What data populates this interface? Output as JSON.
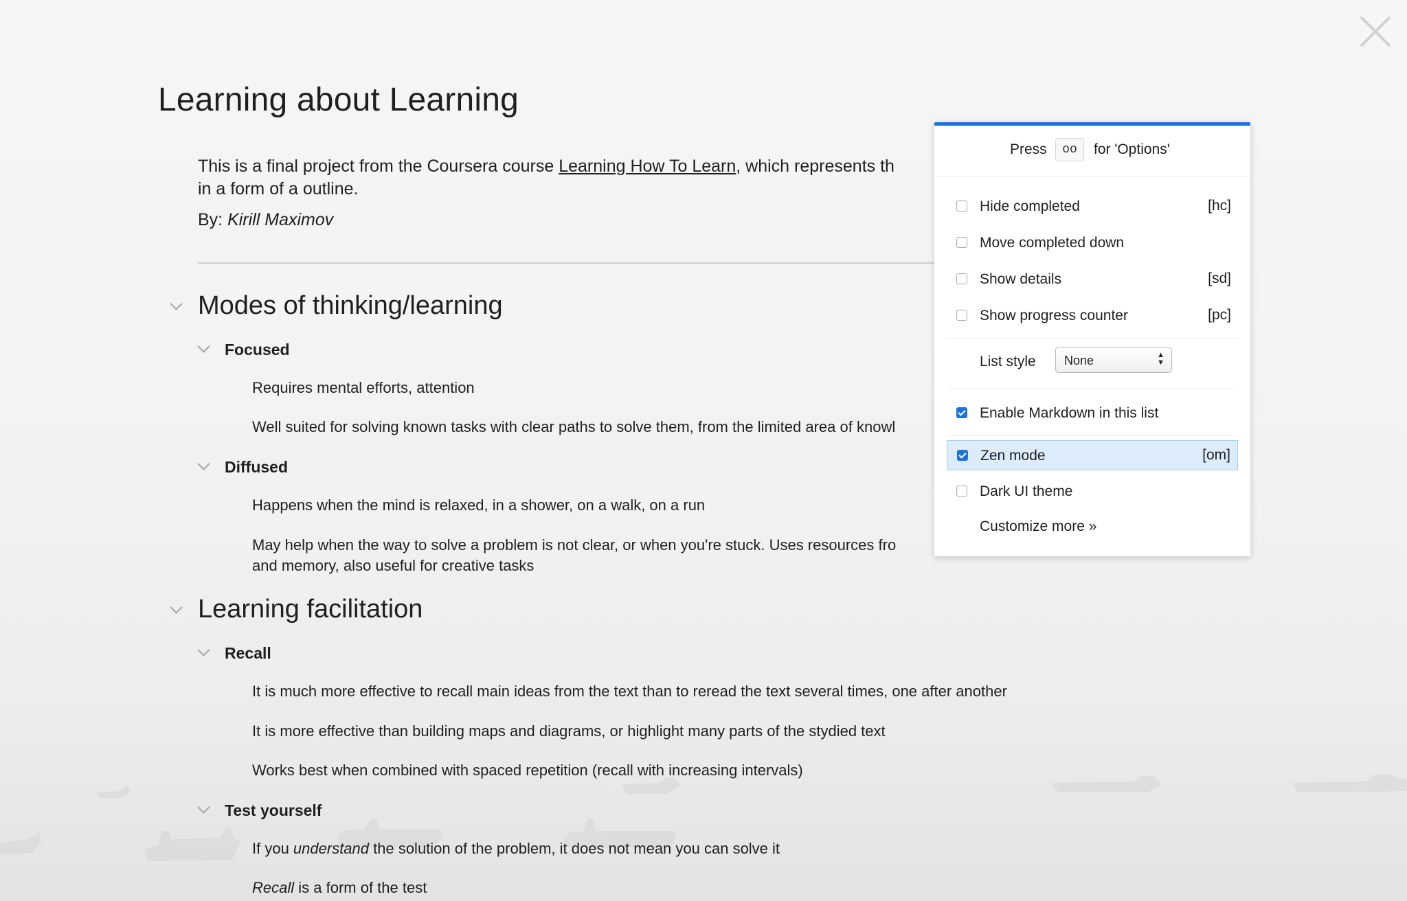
{
  "window": {
    "close_icon": "close-icon"
  },
  "doc": {
    "title": "Learning about Learning",
    "intro_before": "This is a final project from the Coursera course ",
    "intro_link": "Learning How To Learn",
    "intro_after": ", which represents th",
    "intro_line2": "in a form of a outline.",
    "by_prefix": "By: ",
    "author": "Kirill Maximov"
  },
  "outline": {
    "s1": {
      "title": "Modes of thinking/learning",
      "focused": {
        "title": "Focused",
        "n1": "Requires mental efforts, attention",
        "n2": "Well suited for solving known tasks with clear paths to solve them, from the limited area of knowl"
      },
      "diffused": {
        "title": "Diffused",
        "n1": "Happens when the mind is relaxed, in a shower, on a walk, on a run",
        "n2a": "May help when the way to solve a problem is not clear, or when you're stuck. Uses resources fro",
        "n2b": "and memory, also useful for creative tasks"
      }
    },
    "s2": {
      "title": "Learning facilitation",
      "recall": {
        "title": "Recall",
        "n1": "It is much more effective to recall main ideas from the text than to reread the text several times, one after another",
        "n2": "It is more effective than building maps and diagrams, or highlight many parts of the stydied text",
        "n3": "Works best when combined with spaced repetition (recall with increasing intervals)"
      },
      "test": {
        "title": "Test yourself",
        "n1a": "If you ",
        "n1b": "understand",
        "n1c": " the solution of the problem, it does not mean you can solve it",
        "n2a": "Recall",
        "n2b": " is a form of the test"
      }
    }
  },
  "options": {
    "press_label": "Press",
    "press_key": "oo",
    "press_suffix": "for 'Options'",
    "items": [
      {
        "label": "Hide completed",
        "key": "[hc]",
        "checked": false
      },
      {
        "label": "Move completed down",
        "key": "",
        "checked": false
      },
      {
        "label": "Show details",
        "key": "[sd]",
        "checked": false
      },
      {
        "label": "Show progress counter",
        "key": "[pc]",
        "checked": false
      }
    ],
    "list_style_label": "List style",
    "list_style_value": "None",
    "markdown": {
      "label": "Enable Markdown in this list",
      "checked": true
    },
    "zen": {
      "label": "Zen mode",
      "key": "[om]",
      "checked": true
    },
    "dark": {
      "label": "Dark UI theme",
      "checked": false
    },
    "customize": "Customize more »"
  }
}
